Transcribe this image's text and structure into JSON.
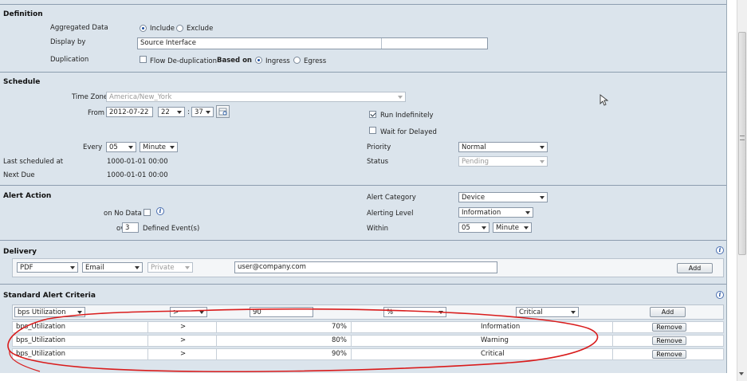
{
  "definition": {
    "title": "Definition",
    "aggregated_label": "Aggregated Data",
    "include": "Include",
    "exclude": "Exclude",
    "display_label": "Display by",
    "display_value": "Source Interface",
    "dup_label": "Duplication",
    "flow_dedup": "Flow De-duplication",
    "based_on": "Based on",
    "ingress": "Ingress",
    "egress": "Egress"
  },
  "schedule": {
    "title": "Schedule",
    "tz_label": "Time Zone",
    "tz_value": "America/New_York",
    "from_label": "From",
    "date": "2012-07-22",
    "hour": "22",
    "colon": ":",
    "minute": "37",
    "run_indef": "Run Indefinitely",
    "wait_delayed": "Wait for Delayed",
    "every_label": "Every",
    "every_value": "05",
    "every_unit": "Minute",
    "priority_label": "Priority",
    "priority_value": "Normal",
    "last_label": "Last scheduled at",
    "last_value": "1000-01-01 00:00",
    "status_label": "Status",
    "status_value": "Pending",
    "next_label": "Next Due",
    "next_value": "1000-01-01 00:00"
  },
  "alert": {
    "title": "Alert Action",
    "nodata_label": "on No Data",
    "category_label": "Alert Category",
    "category_value": "Device",
    "level_label": "Alerting Level",
    "level_value": "Information",
    "over_label": "over",
    "over_value": "3",
    "defined_events": "Defined Event(s)",
    "within_label": "Within",
    "within_value": "05",
    "within_unit": "Minute"
  },
  "delivery": {
    "title": "Delivery",
    "format": "PDF",
    "method": "Email",
    "privacy": "Private",
    "email": "user@company.com",
    "add": "Add"
  },
  "criteria": {
    "title": "Standard Alert Criteria",
    "metric": "bps Utilization",
    "operator": ">",
    "threshold": "90",
    "unit": "%",
    "severity": "Critical",
    "add": "Add",
    "rows": [
      {
        "metric": "bps_Utilization",
        "op": ">",
        "value": "70%",
        "level": "Information",
        "action": "Remove"
      },
      {
        "metric": "bps_Utilization",
        "op": ">",
        "value": "80%",
        "level": "Warning",
        "action": "Remove"
      },
      {
        "metric": "bps_Utilization",
        "op": ">",
        "value": "90%",
        "level": "Critical",
        "action": "Remove"
      }
    ]
  },
  "icons": {
    "info": "i",
    "calendar": "calendar-icon",
    "cursor": "cursor-icon"
  },
  "colors": {
    "panel_bg": "#dbe4ec",
    "annotation_red": "#d91c1c"
  }
}
